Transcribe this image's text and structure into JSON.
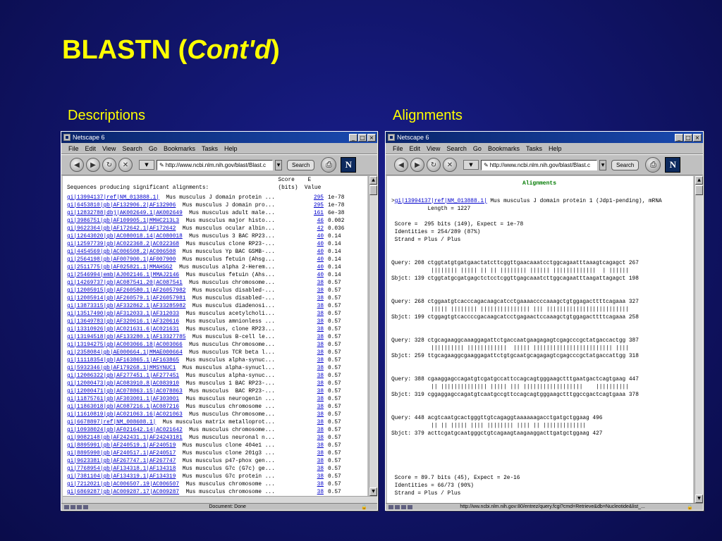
{
  "slide": {
    "title_main": "BLASTN (",
    "title_italic": "Cont'd",
    "title_end": ")",
    "left_caption": "Descriptions",
    "right_caption": "Alignments"
  },
  "browser": {
    "window_title": "Netscape 6",
    "menu": [
      "File",
      "Edit",
      "View",
      "Search",
      "Go",
      "Bookmarks",
      "Tasks",
      "Help"
    ],
    "search_button": "Search",
    "logo_letter": "N"
  },
  "left_window": {
    "url": "http://www.ncbi.nlm.nih.gov/blast/Blast.c",
    "status": "Document: Done",
    "header_line1": "                                                                Score    E",
    "header_line2": "Sequences producing significant alignments:                     (bits)  Value",
    "rows": [
      {
        "id": "gi|13994137|ref|NM_013888.1|",
        "desc": "  Mus musculus J domain protein ...",
        "score": "295",
        "evalue": "1e-78"
      },
      {
        "id": "gi|6453810|gb|AF132906.2|AF132906",
        "desc": "  Mus musculus J domain pro...",
        "score": "295",
        "evalue": "1e-78"
      },
      {
        "id": "gi|12832788|dbj|AK002649.1|AK002649",
        "desc": "  Mus musculus adult male...",
        "score": "161",
        "evalue": "6e-38"
      },
      {
        "id": "gi|3986751|gb|AF109905.1|MMHC213L3",
        "desc": "  Mus musculus major histo...",
        "score": "46",
        "evalue": "0.002"
      },
      {
        "id": "gi|9622364|gb|AF172642.1|AF172642",
        "desc": "  Mus musculus ocular albin...",
        "score": "42",
        "evalue": "0.036"
      },
      {
        "id": "gi|12643020|gb|AC080018.14|AC080018",
        "desc": "  Mus musculus 3 BAC RP23...",
        "score": "40",
        "evalue": "0.14"
      },
      {
        "id": "gi|12597739|gb|AC022368.2|AC022368",
        "desc": "  Mus musculus clone RP23-...",
        "score": "40",
        "evalue": "0.14"
      },
      {
        "id": "gi|4454569|gb|AC006508.2|AC006508",
        "desc": "  Mus musculus Yp BAC GSMB-...",
        "score": "40",
        "evalue": "0.14"
      },
      {
        "id": "gi|2564198|gb|AF007900.1|AF007900",
        "desc": "  Mus musculus fetuin (Ahsg...",
        "score": "40",
        "evalue": "0.14"
      },
      {
        "id": "gi|2511775|gb|AF025821.1|MMAHSG2",
        "desc": "  Mus musculus alpha 2-Herem...",
        "score": "40",
        "evalue": "0.14"
      },
      {
        "id": "gi|2546994|emb|AJ002146.1|MMAJ2146",
        "desc": "  Mus musculus fetuin (Ahs...",
        "score": "40",
        "evalue": "0.14"
      },
      {
        "id": "gi|14269737|gb|AC087541.20|AC087541",
        "desc": "  Mus musculus chromosome...",
        "score": "38",
        "evalue": "0.57"
      },
      {
        "id": "gi|12005915|gb|AF260580.1|AF26057982",
        "desc": "  Mus musculus disabled-...",
        "score": "38",
        "evalue": "0.57"
      },
      {
        "id": "gi|12005914|gb|AF260579.1|AF26057981",
        "desc": "  Mus musculus disabled-...",
        "score": "38",
        "evalue": "0.57"
      },
      {
        "id": "gi|13873315|gb|AF332862.1|AF33285982",
        "desc": "  Mus musculus diadenosi...",
        "score": "38",
        "evalue": "0.57"
      },
      {
        "id": "gi|13517490|gb|AF312033.1|AF312033",
        "desc": "  Mus musculus acetylcholi...",
        "score": "38",
        "evalue": "0.57"
      },
      {
        "id": "gi|13649783|gb|AF320616.1|AF320616",
        "desc": "  Mus musculus amnionless ...",
        "score": "38",
        "evalue": "0.57"
      },
      {
        "id": "gi|13310926|gb|AC021631.6|AC021631",
        "desc": "  Mus musculus, clone RP23...",
        "score": "38",
        "evalue": "0.57"
      },
      {
        "id": "gi|13194518|gb|AF133280.1|AF13327785",
        "desc": "  Mus musculus B-cell le...",
        "score": "38",
        "evalue": "0.57"
      },
      {
        "id": "gi|13194275|gb|AC003066.18|AC003066",
        "desc": "  Mus musculus Chromosome...",
        "score": "38",
        "evalue": "0.57"
      },
      {
        "id": "gi|2358084|gb|AE000664.1|MMAE000664",
        "desc": "  Mus musculus TCR beta l...",
        "score": "38",
        "evalue": "0.57"
      },
      {
        "id": "gi|11118354|gb|AF163865.1|AF163865",
        "desc": "  Mus musculus alpha-synuc...",
        "score": "38",
        "evalue": "0.57"
      },
      {
        "id": "gi|5932346|gb|AF179268.1|MMSYNUC1",
        "desc": "  Mus musculus alpha-synucl...",
        "score": "38",
        "evalue": "0.57"
      },
      {
        "id": "gi|12006322|gb|AF277451.1|AF277451",
        "desc": "  Mus musculus alpha-synuc...",
        "score": "38",
        "evalue": "0.57"
      },
      {
        "id": "gi|12000473|gb|AC083910.8|AC083910",
        "desc": "  Mus musculus 1 BAC RP23-...",
        "score": "38",
        "evalue": "0.57"
      },
      {
        "id": "gi|12000471|gb|AC078863.15|AC078863",
        "desc": "  Mus musculus  BAC RP23-...",
        "score": "38",
        "evalue": "0.57"
      },
      {
        "id": "gi|11875761|gb|AF303001.1|AF303001",
        "desc": "  Mus musculus neurogenin ...",
        "score": "38",
        "evalue": "0.57"
      },
      {
        "id": "gi|11863018|gb|AC087216.1|AC087216",
        "desc": "  Mus musculus chromosome ...",
        "score": "38",
        "evalue": "0.57"
      },
      {
        "id": "gi|11610819|gb|AC021063.16|AC021063",
        "desc": "  Mus musculus Chromosome...",
        "score": "38",
        "evalue": "0.57"
      },
      {
        "id": "gi|6678897|ref|NM_008608.1|",
        "desc": "  Mus musculus matrix metalloprot...",
        "score": "38",
        "evalue": "0.57"
      },
      {
        "id": "gi|10938024|gb|AF021642.14|AC021642",
        "desc": "  Mus musculus chromosome...",
        "score": "38",
        "evalue": "0.57"
      },
      {
        "id": "gi|9082148|gb|AF242431.1|AF24243181",
        "desc": "  Mus musculus neuronal n...",
        "score": "38",
        "evalue": "0.57"
      },
      {
        "id": "gi|8895991|gb|AF240519.1|AF240519",
        "desc": "  Mus musculus clone 404e1 ...",
        "score": "38",
        "evalue": "0.57"
      },
      {
        "id": "gi|8895990|gb|AF240517.1|AF240517",
        "desc": "  Mus musculus clone 201g3 ...",
        "score": "38",
        "evalue": "0.57"
      },
      {
        "id": "gi|9623381|gb|AF267747.1|AF267747",
        "desc": "  Mus musculus p47-phox gen...",
        "score": "38",
        "evalue": "0.57"
      },
      {
        "id": "gi|7768954|gb|AF134318.1|AF134318",
        "desc": "  Mus musculus G7c (G7c) ge...",
        "score": "38",
        "evalue": "0.57"
      },
      {
        "id": "gi|7381104|gb|AF134319.1|AF134319",
        "desc": "  Mus musculus G7c protein ...",
        "score": "38",
        "evalue": "0.57"
      },
      {
        "id": "gi|7212021|gb|AC006507.19|AC006507",
        "desc": "  Mus musculus chromosome ...",
        "score": "38",
        "evalue": "0.57"
      },
      {
        "id": "gi|6869287|gb|AC009287.17|AC009287",
        "desc": "  Mus musculus chromosome ...",
        "score": "38",
        "evalue": "0.57"
      }
    ]
  },
  "right_window": {
    "url": "http://www.ncbi.nlm.nih.gov/blast/Blast.c",
    "status": "http://ww.ncbi.nlm.nih.gov:80/entrez/query.fcgi?cmd=Retrieve&db=Nucleotide&list_...",
    "heading": "Alignments",
    "hit_prefix": ">",
    "hit_link": "gi|13994137|ref|NM_013888.1|",
    "hit_desc": " Mus musculus J domain protein 1 (Jdp1-pending), mRNA",
    "length": "           Length = 1227",
    "score_lines": [
      " Score =  295 bits (149), Expect = 1e-78",
      " Identities = 254/289 (87%)",
      " Strand = Plus / Plus"
    ],
    "blocks": [
      [
        "Query: 208 ctggtatgtgatgaactatcttcggttgaacaaatcctggcagaatttaaagtcagagct 267",
        "            |||||||| ||||| || || |||||||| |||||| |||||||||||||  | ||||||",
        "Sbjct: 139 ctggtatgcgatgagctctcctcggttgagcaaatcttggcagaatttaagattagagct 198"
      ],
      [
        "Query: 268 ctggaatgtcacccagacaagcatcctgaaaaccccaaagctgtggagacttttcagaaa 327",
        "            ||||| |||||||| ||||||||||||||| ||| |||||||||||||||||||||||||",
        "Sbjct: 199 ctggagtgtcaccccgacaagcatcctgagaactccaaagctgtggagacttttcagaaa 258"
      ],
      [
        "Query: 328 ctgcagaaggcaaaggagattctgaccaatgaagagagtcgagcccgctatgaccactgg 387",
        "            |||||||||| ||||||||||||  ||||| |||||||||||||||||||||||| ||||",
        "Sbjct: 259 ttgcagaaggcgaaggagattctgtgcaatgcagagagtcgagcccgctatgaccattgg 318"
      ],
      [
        "Query: 388 cgaaggagccagatgtcgatgccattccagcagtgggaagctttgaatgactcagtgaag 447",
        "            || |||||||||||||| ||||| ||| ||||||||||||||||||    ||||||||||",
        "Sbjct: 319 cggaggagccagatgtcaatgccgttccagcagtgggaagctttggccgactcagtgaaa 378"
      ],
      [
        "Query: 448 acgtcaatgcactgggttgtcagaggtaaaaaagacctgatgctggaag 496",
        "            || || ||||| |||| |||||||| |||| || |||||||||||||",
        "Sbjct: 379 acttcgatgcaatgggctgtcagaagtaagaaggacttgatgctggaag 427"
      ]
    ],
    "score_lines2": [
      " Score = 89.7 bits (45), Expect = 2e-16",
      " Identities = 66/73 (90%)",
      " Strand = Plus / Plus"
    ]
  }
}
